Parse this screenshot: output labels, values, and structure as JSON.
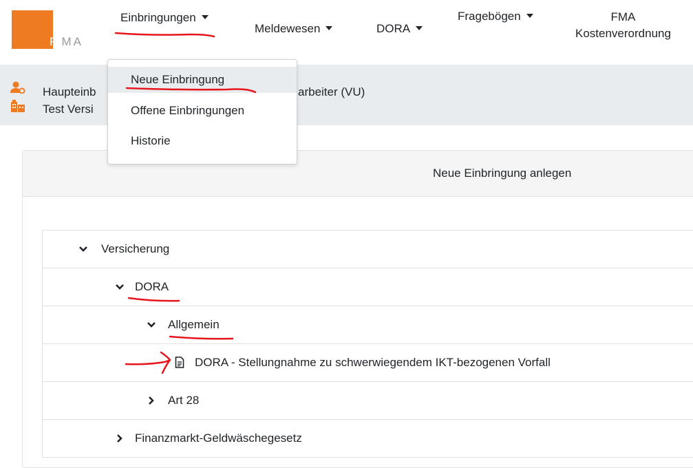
{
  "brand": {
    "logo_text": "FMA"
  },
  "nav": {
    "items": [
      {
        "label": "Einbringungen",
        "has_caret": true
      },
      {
        "label": "Meldewesen",
        "has_caret": true
      },
      {
        "label": "DORA",
        "has_caret": true
      },
      {
        "label": "Fragebögen",
        "has_caret": true
      },
      {
        "label_line1": "FMA",
        "label_line2": "Kostenverordnung",
        "has_caret": false
      }
    ]
  },
  "context": {
    "line1": "Haupteinb",
    "line1_tail": "arbeiter (VU)",
    "line2": "Test Versi",
    "user_icon": "user-gear-icon",
    "company_icon": "building-icon",
    "icon_color": "#ee7b22"
  },
  "dropdown": {
    "items": [
      {
        "label": "Neue Einbringung",
        "active": true
      },
      {
        "label": "Offene Einbringungen",
        "active": false
      },
      {
        "label": "Historie",
        "active": false
      }
    ]
  },
  "card": {
    "title": "Neue Einbringung anlegen"
  },
  "tree": [
    {
      "label": "Versicherung",
      "level": 0,
      "state": "expanded"
    },
    {
      "label": "DORA",
      "level": 1,
      "state": "expanded"
    },
    {
      "label": "Allgemein",
      "level": 2,
      "state": "expanded"
    },
    {
      "label": "DORA - Stellungnahme zu schwerwiegendem IKT-bezogenen Vorfall",
      "level": 2,
      "state": "document",
      "icon": "document-icon"
    },
    {
      "label": "Art 28",
      "level": 2,
      "state": "collapsed"
    },
    {
      "label": "Finanzmarkt-Geldwäschegesetz",
      "level": 1,
      "state": "collapsed"
    }
  ],
  "colors": {
    "brand_orange": "#ee7b22",
    "annotation_red": "#e8141c"
  }
}
